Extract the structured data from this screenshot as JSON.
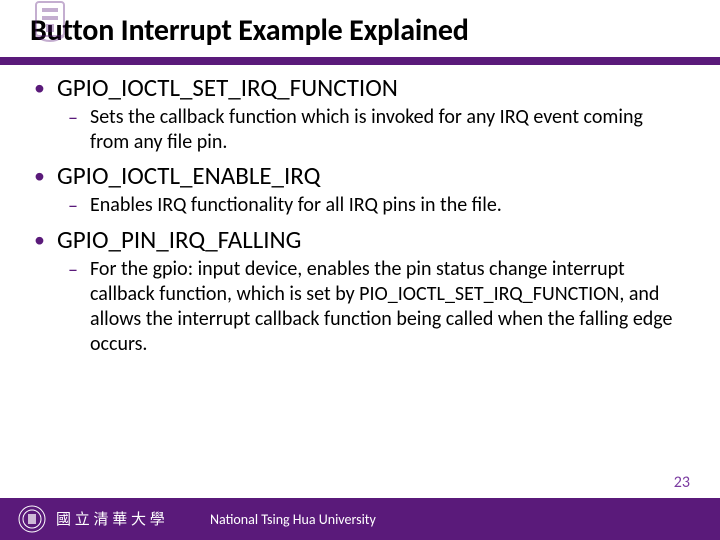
{
  "title": "Button Interrupt Example Explained",
  "bullets": [
    {
      "label": "GPIO_IOCTL_SET_IRQ_FUNCTION",
      "subs": [
        "Sets the callback function which is invoked for any IRQ event coming from any file pin."
      ]
    },
    {
      "label": "GPIO_IOCTL_ENABLE_IRQ",
      "subs": [
        "Enables IRQ functionality for all IRQ pins in the file."
      ]
    },
    {
      "label": "GPIO_PIN_IRQ_FALLING",
      "subs": [
        "For the gpio: input device, enables the pin status change interrupt callback function, which is set by PIO_IOCTL_SET_IRQ_FUNCTION, and allows the interrupt callback function being called when the falling edge occurs."
      ]
    }
  ],
  "footer": {
    "university": "National Tsing Hua University"
  },
  "pageNumber": "23",
  "colors": {
    "accent": "#5a1a7a"
  }
}
